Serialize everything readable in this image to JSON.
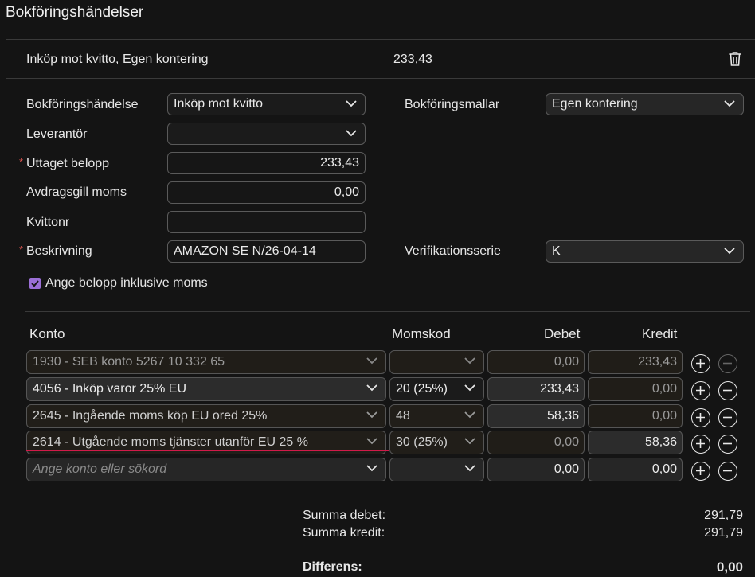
{
  "page": {
    "title": "Bokföringshändelser"
  },
  "header": {
    "title": "Inköp mot kvitto, Egen kontering",
    "amount": "233,43"
  },
  "form": {
    "event_label": "Bokföringshändelse",
    "event_value": "Inköp mot kvitto",
    "supplier_label": "Leverantör",
    "supplier_value": "",
    "withdrawn_label": "Uttaget belopp",
    "withdrawn_value": "233,43",
    "vat_label": "Avdragsgill moms",
    "vat_value": "0,00",
    "receipt_label": "Kvittonr",
    "receipt_value": "",
    "description_label": "Beskrivning",
    "description_value": "AMAZON SE  N/26-04-14",
    "template_label": "Bokföringsmallar",
    "template_value": "Egen kontering",
    "series_label": "Verifikationsserie",
    "series_value": "K",
    "incl_vat_label": "Ange belopp inklusive moms",
    "required_mark": "*"
  },
  "table": {
    "headers": {
      "account": "Konto",
      "vatcode": "Momskod",
      "debit": "Debet",
      "credit": "Kredit"
    },
    "rows": [
      {
        "account": "1930 - SEB konto 5267 10 332 65",
        "vatcode": "",
        "debit": "0,00",
        "credit": "233,43"
      },
      {
        "account": "4056 - Inköp varor 25% EU",
        "vatcode": "20 (25%)",
        "debit": "233,43",
        "credit": "0,00"
      },
      {
        "account": "2645 - Ingående moms köp EU ored 25%",
        "vatcode": "48",
        "debit": "58,36",
        "credit": "0,00"
      },
      {
        "account": "2614 - Utgående moms tjänster utanför EU 25 %",
        "vatcode": "30 (25%)",
        "debit": "0,00",
        "credit": "58,36"
      },
      {
        "account": "",
        "vatcode": "",
        "debit": "0,00",
        "credit": "0,00"
      }
    ],
    "new_row_placeholder": "Ange konto eller sökord"
  },
  "summary": {
    "debit_label": "Summa debet:",
    "debit_value": "291,79",
    "credit_label": "Summa kredit:",
    "credit_value": "291,79",
    "diff_label": "Differens:",
    "diff_value": "0,00"
  },
  "colors": {
    "accent_checkbox": "#9b6fd6",
    "required": "#d9534f",
    "error_underline": "#d11a4a"
  }
}
